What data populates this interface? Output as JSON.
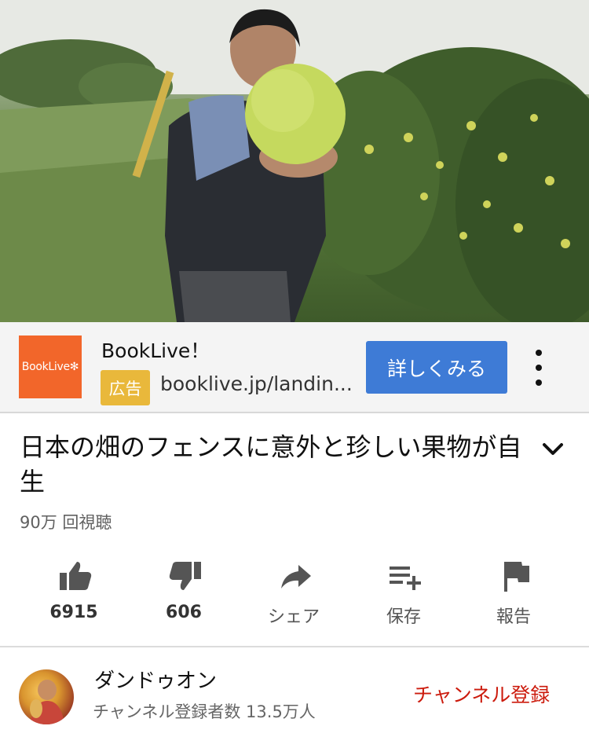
{
  "ad": {
    "logo_text": "BookLive",
    "title": "BookLive！",
    "badge": "広告",
    "url": "booklive.jp/landin...",
    "cta": "詳しくみる"
  },
  "video": {
    "title": "日本の畑のフェンスに意外と珍しい果物が自生",
    "views": "90万 回視聴"
  },
  "actions": {
    "like_count": "6915",
    "dislike_count": "606",
    "share_label": "シェア",
    "save_label": "保存",
    "report_label": "報告"
  },
  "channel": {
    "name": "ダンドゥオン",
    "subscribers": "チャンネル登録者数 13.5万人",
    "subscribe_label": "チャンネル登録"
  },
  "colors": {
    "cta_blue": "#3e7bd6",
    "ad_badge_yellow": "#e9b83b",
    "logo_orange": "#f2662a",
    "subscribe_red": "#cc1b0d"
  }
}
